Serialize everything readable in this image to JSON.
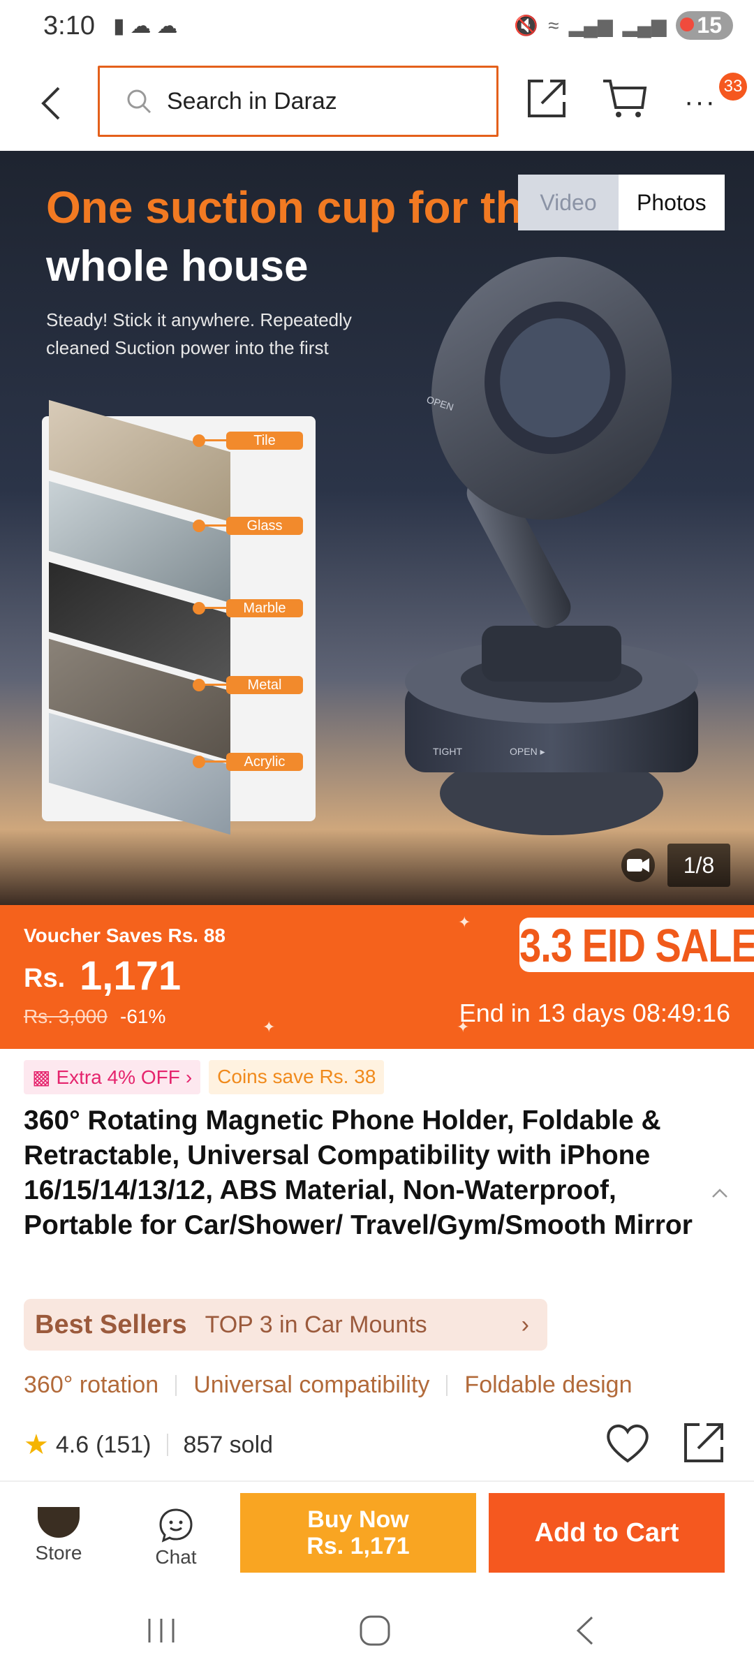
{
  "status_bar": {
    "time": "3:10",
    "battery": "15"
  },
  "top_bar": {
    "search_placeholder": "Search in Daraz",
    "cart_badge": "33"
  },
  "hero": {
    "headline_line1": "One suction cup for the",
    "headline_line2": "whole house",
    "subtext": "Steady! Stick it anywhere. Repeatedly cleaned Suction power into the first",
    "materials": [
      "Tile",
      "Glass",
      "Marble",
      "Metal",
      "Acrylic"
    ],
    "media_tabs": {
      "video": "Video",
      "photos": "Photos"
    },
    "image_counter": "1/8",
    "product_markings": {
      "open": "OPEN",
      "tight": "TIGHT",
      "base_open": "OPEN ▸"
    }
  },
  "sale": {
    "voucher": "Voucher Saves Rs. 88",
    "currency": "Rs.",
    "price": "1,171",
    "original_price": "Rs. 3,000",
    "discount": "-61%",
    "event": "3.3 EID SALE",
    "countdown": "End in 13 days 08:49:16"
  },
  "promos": {
    "extra": "Extra 4% OFF",
    "coins": "Coins save Rs. 38"
  },
  "product": {
    "title": "360° Rotating Magnetic Phone Holder, Foldable & Retractable, Universal Compatibility with iPhone 16/15/14/13/12, ABS Material, Non-Waterproof, Portable for Car/Shower/ Travel/Gym/Smooth Mirror"
  },
  "bestseller": {
    "label": "Best Sellers",
    "rank": "TOP 3 in Car Mounts"
  },
  "features": [
    "360° rotation",
    "Universal compatibility",
    "Foldable design"
  ],
  "rating": {
    "score": "4.6",
    "count": "(151)",
    "sold": "857 sold"
  },
  "action_bar": {
    "store": "Store",
    "chat": "Chat",
    "buy_now": "Buy Now",
    "buy_now_price": "Rs. 1,171",
    "add_to_cart": "Add to Cart"
  },
  "colors": {
    "brand_orange": "#f5581f",
    "buy_now_yellow": "#f9a522",
    "search_border": "#e4601b"
  }
}
